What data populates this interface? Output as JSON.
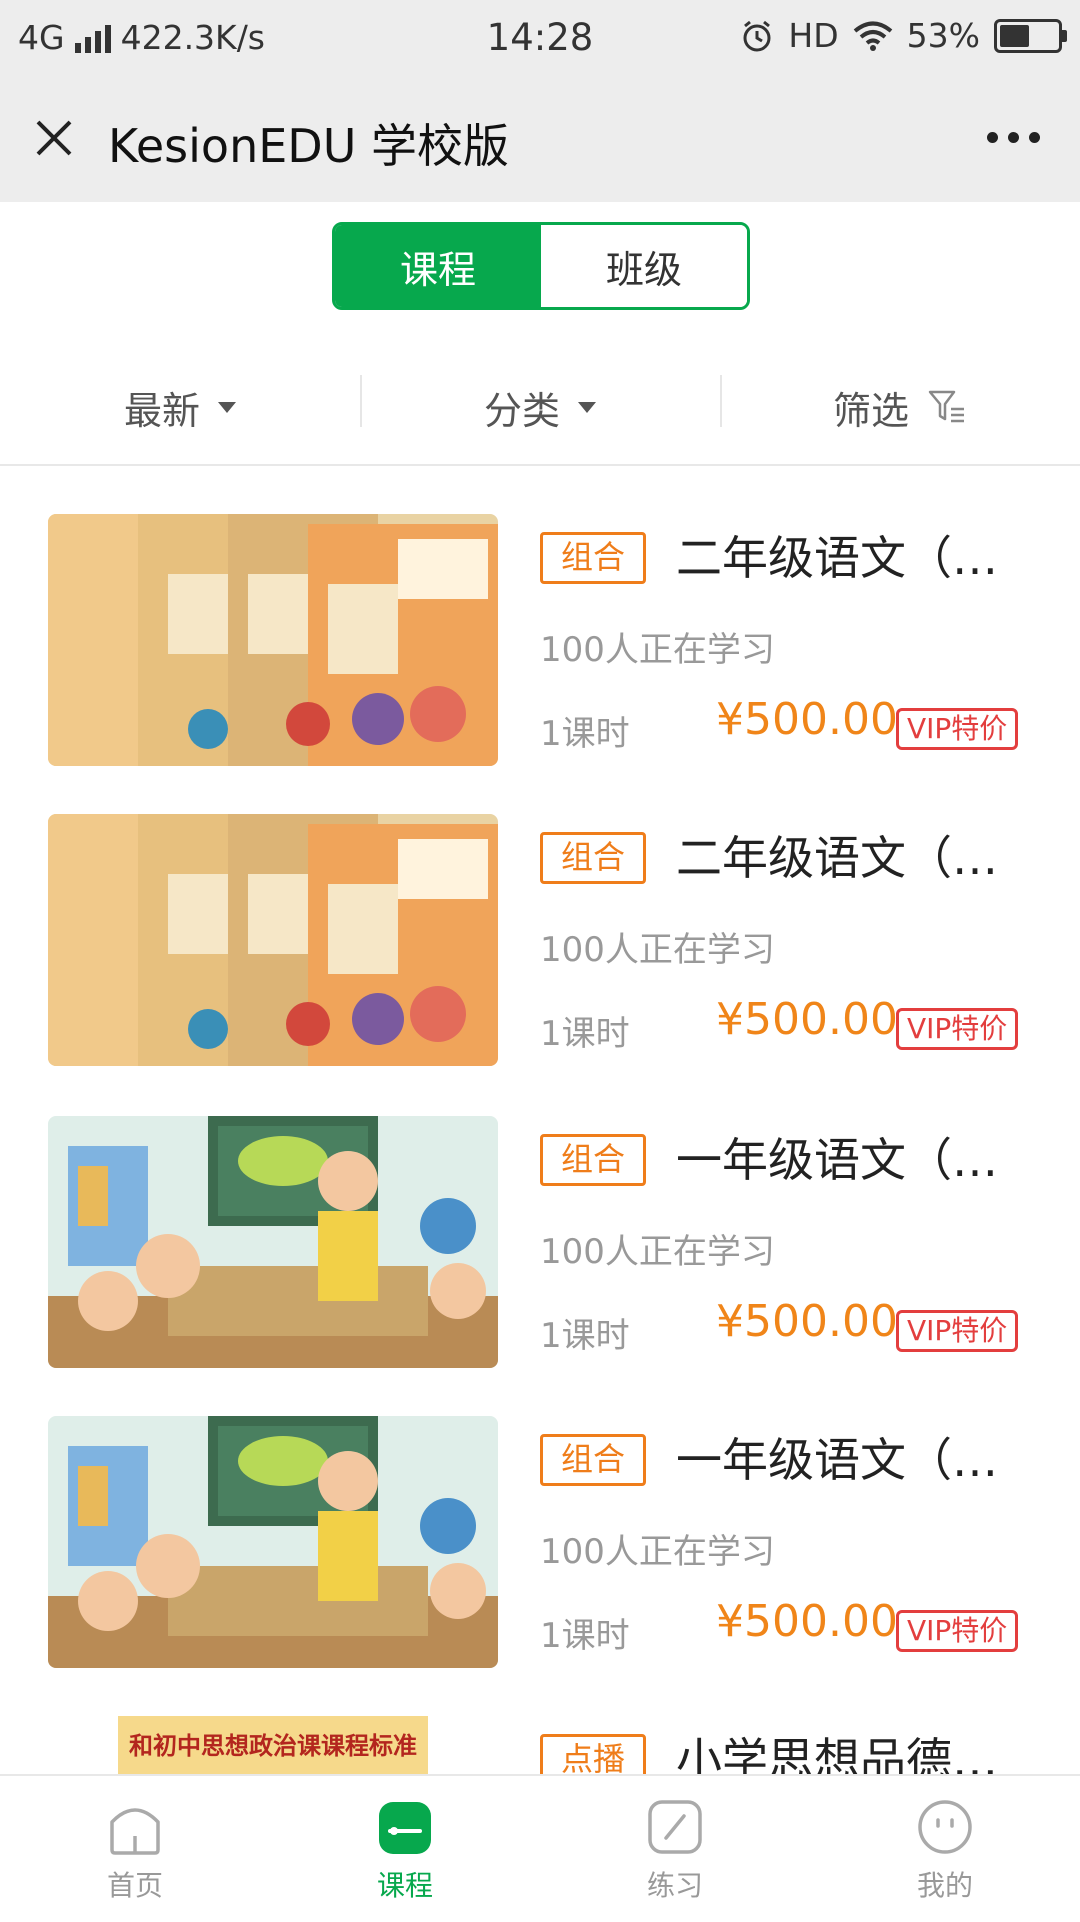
{
  "status_bar": {
    "network": "4G",
    "speed": "422.3K/s",
    "time": "14:28",
    "hd": "HD",
    "battery": "53%"
  },
  "app": {
    "title": "KesionEDU 学校版"
  },
  "segmented_tabs": [
    {
      "label": "课程",
      "active": true
    },
    {
      "label": "班级",
      "active": false
    }
  ],
  "filters": {
    "sort_label": "最新",
    "category_label": "分类",
    "filter_label": "筛选"
  },
  "courses": [
    {
      "tag": "组合",
      "title": "二年级语文（…",
      "learners": "100人正在学习",
      "hours": "1课时",
      "price": "¥500.00",
      "vip": "VIP特价",
      "thumb": "textbooks"
    },
    {
      "tag": "组合",
      "title": "二年级语文（…",
      "learners": "100人正在学习",
      "hours": "1课时",
      "price": "¥500.00",
      "vip": "VIP特价",
      "thumb": "textbooks"
    },
    {
      "tag": "组合",
      "title": "一年级语文（…",
      "learners": "100人正在学习",
      "hours": "1课时",
      "price": "¥500.00",
      "vip": "VIP特价",
      "thumb": "classroom"
    },
    {
      "tag": "组合",
      "title": "一年级语文（…",
      "learners": "100人正在学习",
      "hours": "1课时",
      "price": "¥500.00",
      "vip": "VIP特价",
      "thumb": "classroom"
    },
    {
      "tag": "点播",
      "title": "小学思想品德…",
      "thumb_text": "和初中思想政治课课程标准"
    }
  ],
  "bottom_nav": [
    {
      "label": "首页",
      "icon": "home-icon",
      "active": false
    },
    {
      "label": "课程",
      "icon": "course-icon",
      "active": true
    },
    {
      "label": "练习",
      "icon": "practice-icon",
      "active": false
    },
    {
      "label": "我的",
      "icon": "profile-icon",
      "active": false
    }
  ],
  "colors": {
    "primary_green": "#07a84d",
    "price_orange": "#f08519",
    "tag_orange": "#ef7d1a",
    "vip_red": "#e33e3e"
  }
}
